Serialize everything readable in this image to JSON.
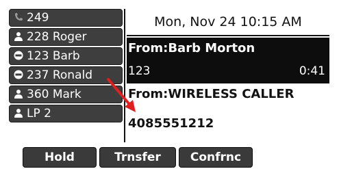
{
  "sidebar": {
    "line_keys": [
      {
        "label": "249",
        "icon": "phone-handset-icon"
      },
      {
        "label": "228 Roger",
        "icon": "contact-person-icon"
      },
      {
        "label": "123 Barb",
        "icon": "do-not-disturb-icon"
      },
      {
        "label": "237 Ronald",
        "icon": "do-not-disturb-icon"
      },
      {
        "label": "360 Mark",
        "icon": "contact-person-icon"
      },
      {
        "label": "LP 2",
        "icon": "contact-person-icon"
      }
    ]
  },
  "status": {
    "datetime": "Mon, Nov 24  10:15 AM"
  },
  "active_call": {
    "from": "From:Barb Morton",
    "number": "123",
    "timer": "0:41"
  },
  "other_call": {
    "from": "From:WIRELESS CALLER",
    "number": "4085551212"
  },
  "softkeys": {
    "hold": "Hold",
    "transfer": "Trnsfer",
    "conference": "Confrnc"
  },
  "colors": {
    "key_background": "#3e3e3e",
    "active_call_background": "#0d0d0d",
    "annotation_arrow": "#e02020"
  }
}
